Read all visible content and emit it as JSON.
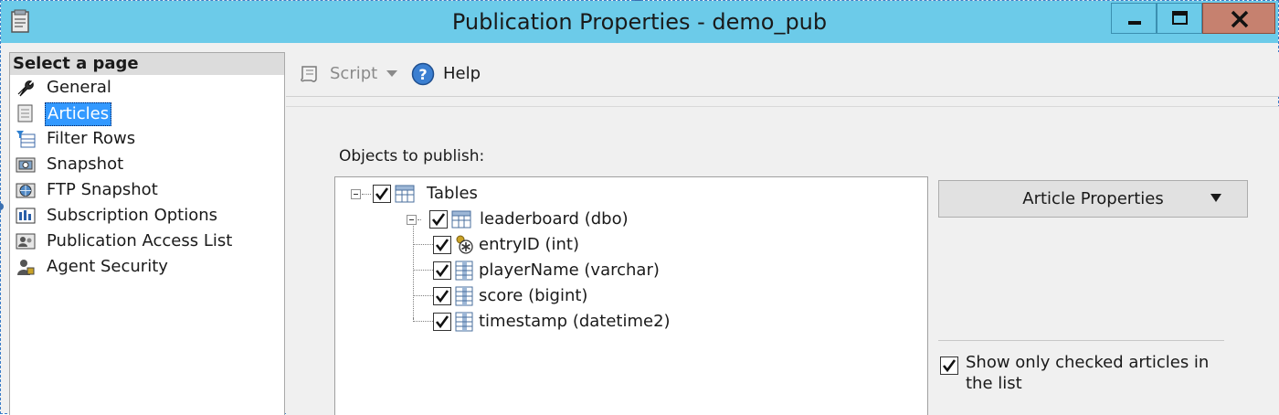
{
  "window": {
    "title": "Publication Properties - demo_pub",
    "controls": {
      "minimize": "minimize",
      "maximize": "maximize",
      "close": "close"
    },
    "title_bar_color": "#6ccbe9",
    "close_button_color": "#c6816f"
  },
  "sidebar": {
    "header": "Select a page",
    "items": [
      {
        "label": "General",
        "icon": "wrench-icon"
      },
      {
        "label": "Articles",
        "icon": "articles-icon",
        "selected": true
      },
      {
        "label": "Filter Rows",
        "icon": "filter-rows-icon"
      },
      {
        "label": "Snapshot",
        "icon": "snapshot-icon"
      },
      {
        "label": "FTP Snapshot",
        "icon": "ftp-snapshot-icon"
      },
      {
        "label": "Subscription Options",
        "icon": "subscription-options-icon"
      },
      {
        "label": "Publication Access List",
        "icon": "access-list-icon"
      },
      {
        "label": "Agent Security",
        "icon": "agent-security-icon"
      }
    ],
    "selection_color": "#3399ff"
  },
  "toolbar": {
    "script_label": "Script",
    "help_label": "Help"
  },
  "main": {
    "objects_label": "Objects to publish:",
    "tree": [
      {
        "label": "Tables",
        "checked": true,
        "expanded": true
      },
      {
        "label": "leaderboard (dbo)",
        "checked": true,
        "expanded": true
      },
      {
        "label": "entryID (int)",
        "checked": true,
        "key": true
      },
      {
        "label": "playerName (varchar)",
        "checked": true
      },
      {
        "label": "score (bigint)",
        "checked": true
      },
      {
        "label": "timestamp (datetime2)",
        "checked": true
      }
    ],
    "article_properties_label": "Article Properties",
    "show_only_checked_label": "Show only checked articles in the list",
    "show_only_checked": true
  }
}
